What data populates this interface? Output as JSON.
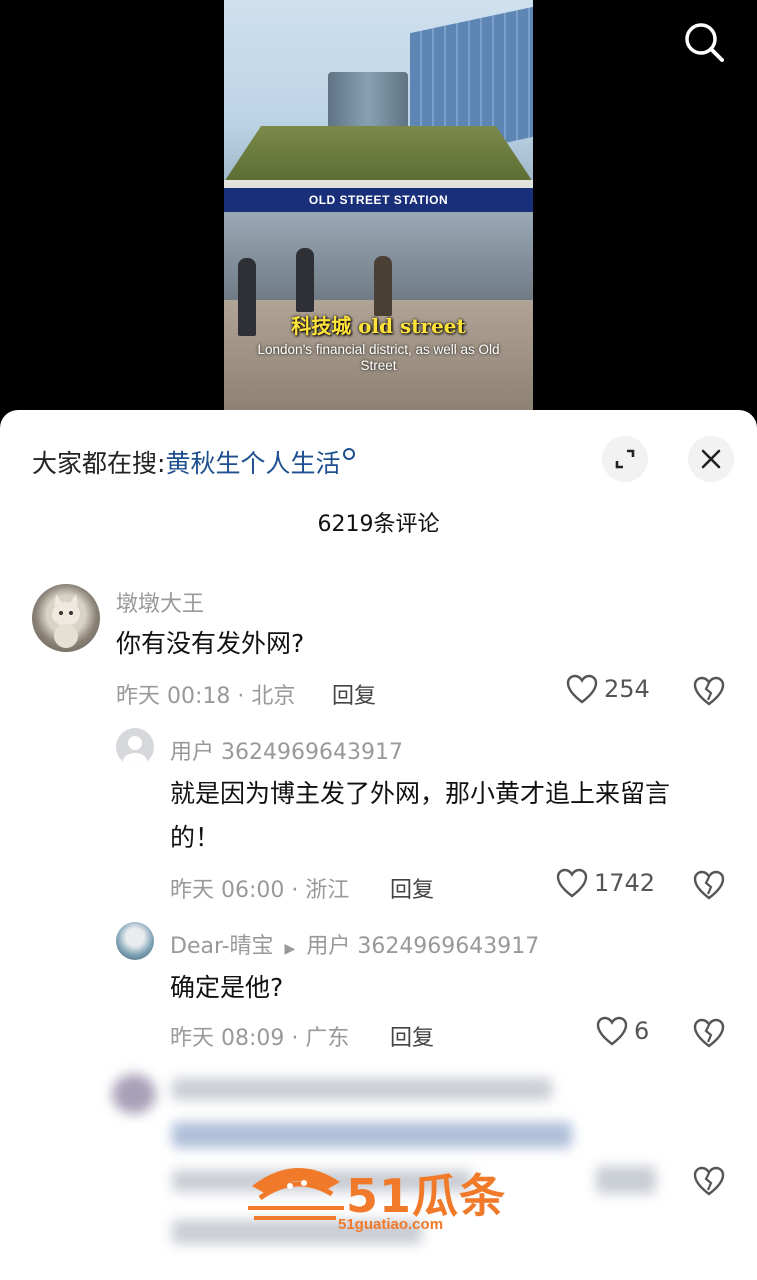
{
  "video": {
    "station_sign": "OLD STREET STATION",
    "caption_title": "科技城 old street",
    "caption_sub": "London’s financial district, as well as Old Street"
  },
  "header": {
    "search_prefix": "大家都在搜:",
    "search_keyword": "黄秋生个人生活",
    "comment_count": "6219条评论"
  },
  "comments": [
    {
      "user": "墩墩大王",
      "text": "你有没有发外网?",
      "meta": "昨天 00:18 · 北京",
      "reply": "回复",
      "likes": "254"
    },
    {
      "user": "用户 3624969643917",
      "text": "就是因为博主发了外网，那小黄才追上来留言的！",
      "meta": "昨天 06:00 · 浙江",
      "reply": "回复",
      "likes": "1742"
    },
    {
      "user": "Dear-晴宝",
      "reply_to": "用户 3624969643917",
      "text": "确定是他?",
      "meta": "昨天 08:09 · 广东",
      "reply": "回复",
      "likes": "6"
    }
  ],
  "watermark": {
    "brand": "51瓜条",
    "url": "51guatiao.com"
  }
}
